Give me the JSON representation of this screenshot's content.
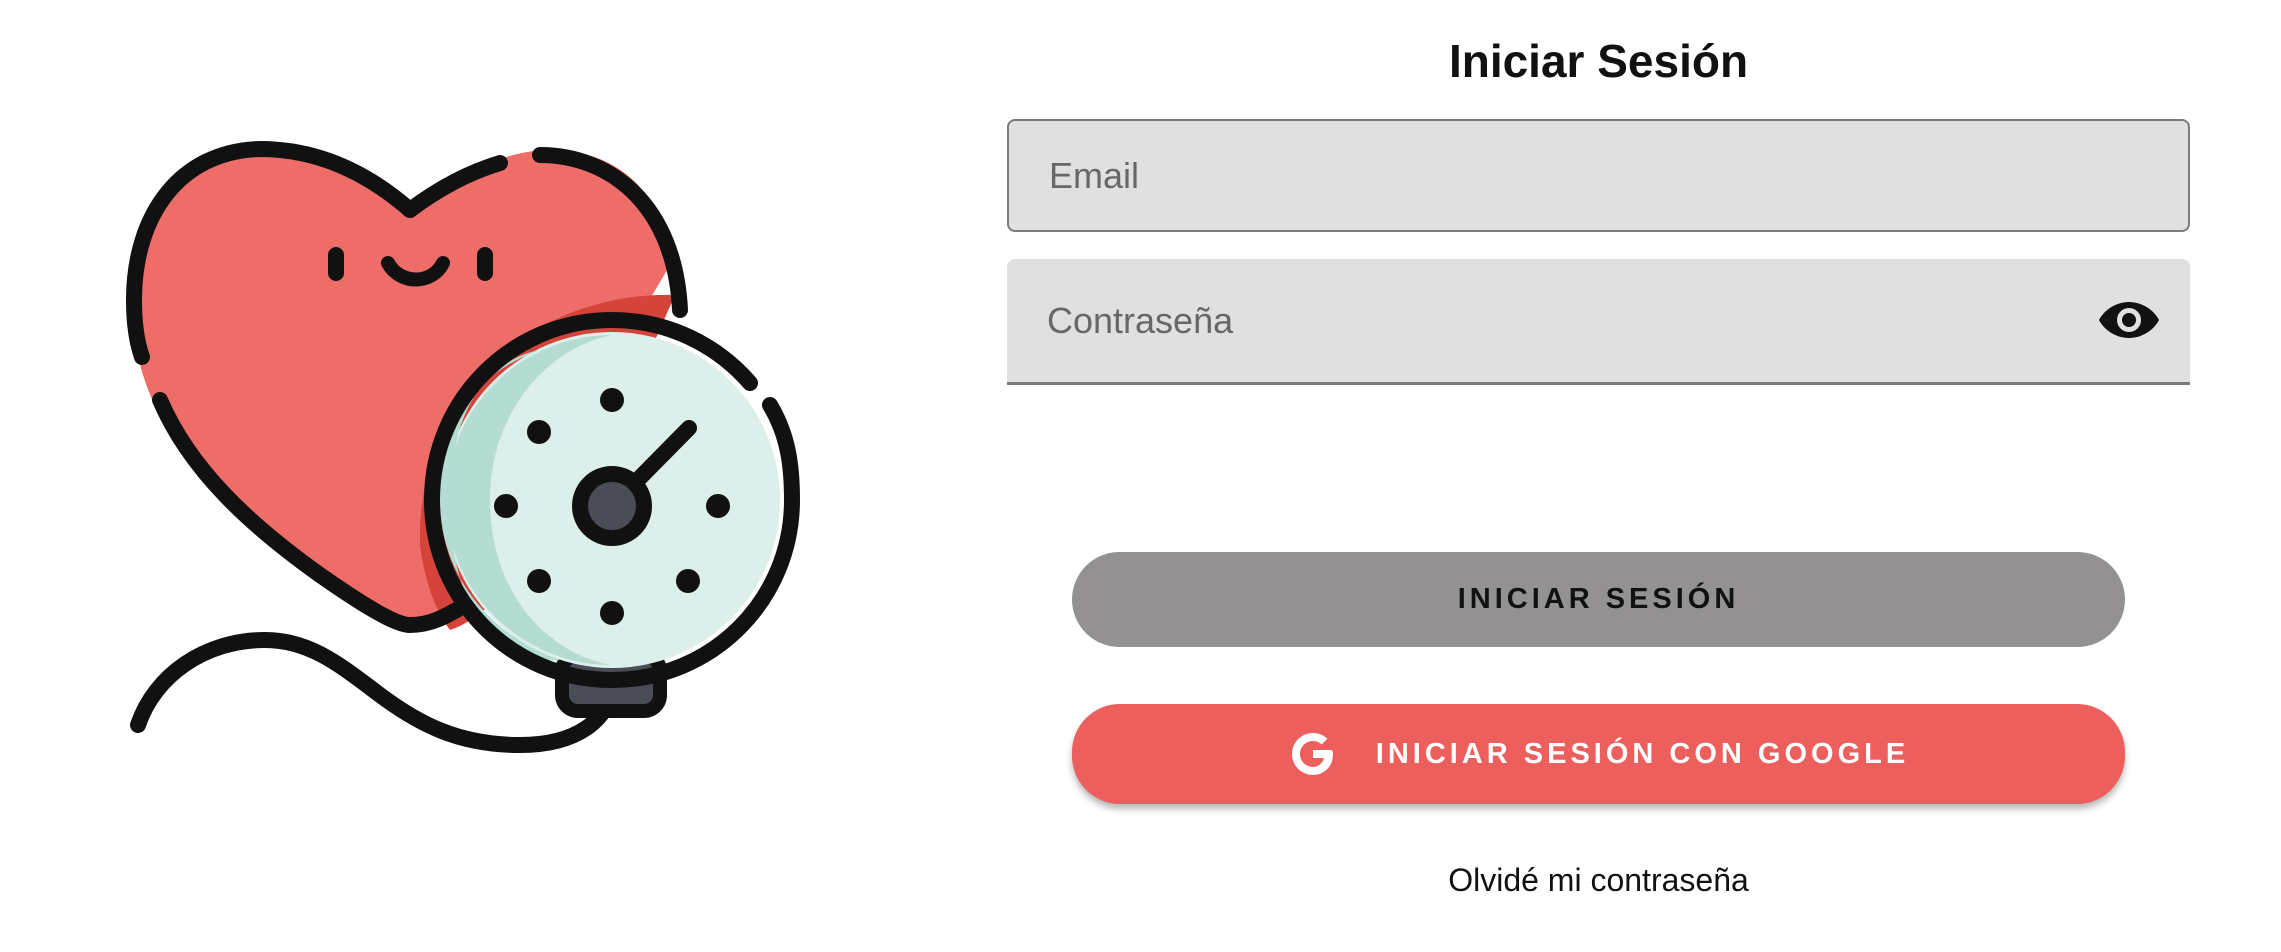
{
  "login": {
    "title": "Iniciar Sesión",
    "email_placeholder": "Email",
    "password_placeholder": "Contraseña",
    "login_button_label": "INICIAR SESIÓN",
    "google_button_label": "INICIAR SESIÓN CON GOOGLE",
    "forgot_password_link": "Olvidé mi contraseña"
  },
  "icons": {
    "illustration": "heart-blood-pressure-gauge-illustration",
    "password_toggle": "eye-icon",
    "google": "google-icon"
  },
  "colors": {
    "heart": "#ee6d69",
    "heart_shadow": "#d6433b",
    "gauge_face": "#dcefea",
    "gauge_shadow": "#b5dcd2",
    "input_background": "#e0e0e0",
    "login_button": "#939192",
    "google_button": "#ec5f5c"
  }
}
